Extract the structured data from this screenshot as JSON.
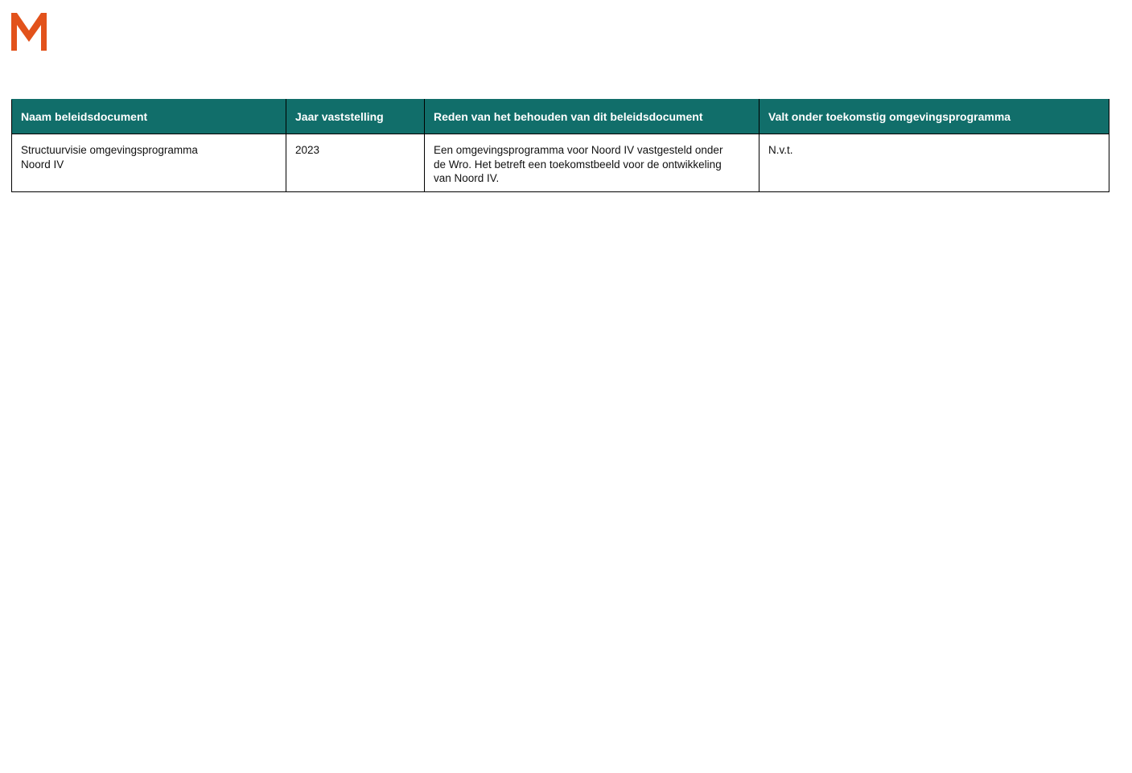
{
  "logo": {
    "name": "M",
    "color": "#e2521b"
  },
  "table": {
    "header_color": "#116e6a",
    "headers": [
      "Naam beleidsdocument",
      "Jaar vaststelling",
      "Reden van het behouden van dit beleidsdocument",
      "Valt onder toekomstig omgevingsprogramma"
    ],
    "rows": [
      {
        "name": "Structuurvisie omgevingsprogramma Noord IV",
        "year": "2023",
        "reason": "Een omgevingsprogramma voor Noord IV vastgesteld onder de Wro. Het betreft een toekomstbeeld voor de ontwikkeling van Noord IV.",
        "program": "N.v.t."
      }
    ]
  }
}
